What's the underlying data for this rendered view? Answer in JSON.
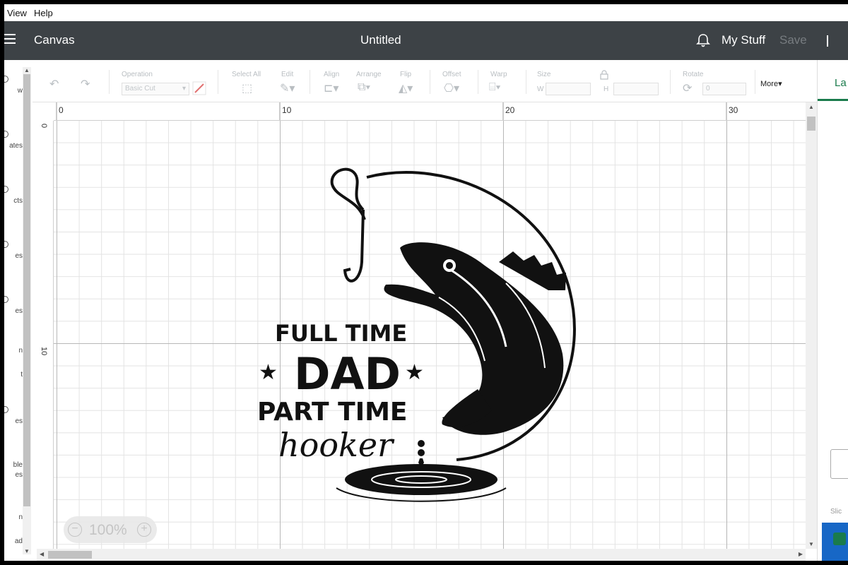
{
  "menu": {
    "items": [
      "View",
      "Help"
    ]
  },
  "header": {
    "app_title": "Canvas",
    "doc_title": "Untitled",
    "my_stuff": "My Stuff",
    "save": "Save"
  },
  "sidebar": {
    "items": [
      "w",
      "ates",
      "cts",
      "es",
      "es",
      "n",
      "t",
      "es",
      "ble",
      "es",
      "n",
      "ad"
    ]
  },
  "toolbar": {
    "operation_label": "Operation",
    "operation_value": "Basic Cut",
    "select_all": "Select All",
    "edit": "Edit",
    "align": "Align",
    "arrange": "Arrange",
    "flip": "Flip",
    "offset": "Offset",
    "warp": "Warp",
    "size": "Size",
    "w": "W",
    "h": "H",
    "rotate": "Rotate",
    "rotate_value": "0",
    "more": "More"
  },
  "rulers": {
    "top": [
      "0",
      "10",
      "20",
      "30"
    ],
    "left": [
      "0",
      "10"
    ]
  },
  "canvas_art": {
    "line1": "FULL TIME",
    "line2": "DAD",
    "line3": "PART TIME",
    "line4": "hooker"
  },
  "zoom": {
    "value": "100%",
    "minus": "−",
    "plus": "+"
  },
  "right_panel": {
    "tab": "La",
    "slice": "Slic"
  },
  "colors": {
    "header": "#3d4246",
    "accent": "#1a7b4c",
    "make_button": "#1767c6"
  }
}
